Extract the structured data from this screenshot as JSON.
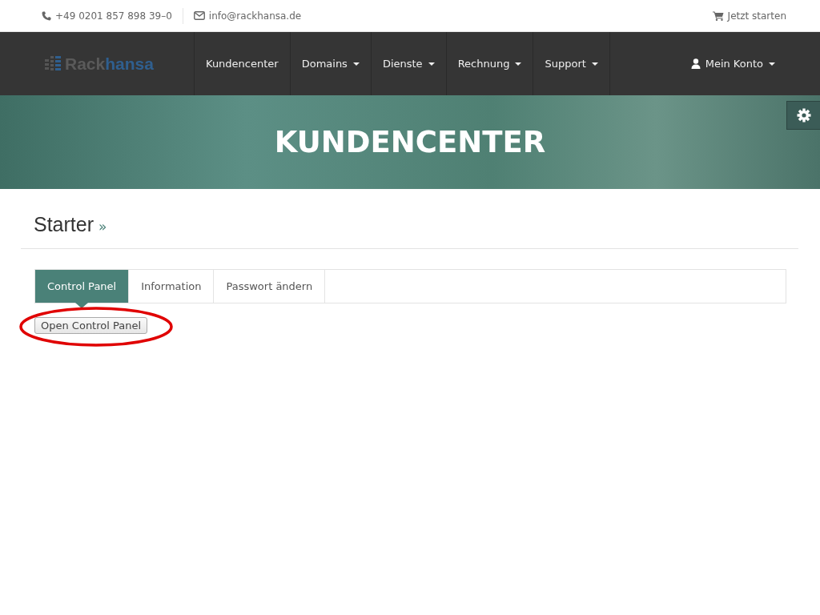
{
  "topbar": {
    "phone": "+49 0201 857 898 39–0",
    "email": "info@rackhansa.de",
    "cart_link": "Jetzt starten"
  },
  "logo": {
    "part_1": "Rack",
    "part_2": "hansa"
  },
  "nav": [
    {
      "label": "Kundencenter",
      "dropdown": false
    },
    {
      "label": "Domains",
      "dropdown": true
    },
    {
      "label": "Dienste",
      "dropdown": true
    },
    {
      "label": "Rechnung",
      "dropdown": true
    },
    {
      "label": "Support",
      "dropdown": true
    }
  ],
  "account": {
    "label": "Mein Konto",
    "dropdown": true
  },
  "hero": {
    "title": "KUNDENCENTER"
  },
  "page": {
    "title": "Starter",
    "title_mark": "»"
  },
  "tabs": [
    {
      "label": "Control Panel",
      "selected": true
    },
    {
      "label": "Information",
      "selected": false
    },
    {
      "label": "Passwort ändern",
      "selected": false
    }
  ],
  "action_button": "Open Control Panel"
}
